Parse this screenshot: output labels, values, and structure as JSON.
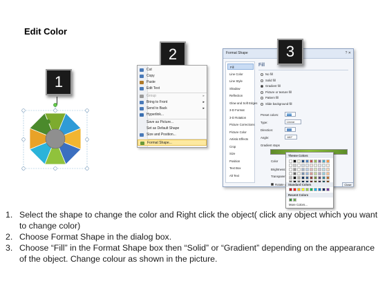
{
  "title": "Edit Color",
  "badges": [
    "1",
    "2",
    "3"
  ],
  "context_menu": {
    "items": [
      {
        "label": "Cut",
        "icon": "scissors-icon",
        "state": "normal"
      },
      {
        "label": "Copy",
        "icon": "copy-icon",
        "state": "normal"
      },
      {
        "label": "Paste",
        "icon": "paste-icon",
        "state": "normal"
      },
      {
        "label": "Edit Text",
        "icon": "text-icon",
        "state": "normal"
      },
      {
        "label": "Group",
        "icon": "group-icon",
        "state": "disabled",
        "submenu": true
      },
      {
        "label": "Bring to Front",
        "icon": "bring-front-icon",
        "state": "normal",
        "submenu": true
      },
      {
        "label": "Send to Back",
        "icon": "send-back-icon",
        "state": "normal",
        "submenu": true
      },
      {
        "label": "Hyperlink...",
        "icon": "hyperlink-icon",
        "state": "normal"
      },
      {
        "label": "Save as Picture...",
        "icon": "",
        "state": "normal"
      },
      {
        "label": "Set as Default Shape",
        "icon": "",
        "state": "normal"
      },
      {
        "label": "Size and Position...",
        "icon": "size-icon",
        "state": "normal"
      },
      {
        "label": "Format Shape...",
        "icon": "format-shape-icon",
        "state": "highlighted"
      }
    ]
  },
  "format_dialog": {
    "title": "Format Shape",
    "window_buttons": "? ✕",
    "nav": [
      "Fill",
      "Line Color",
      "Line Style",
      "Shadow",
      "Reflection",
      "Glow and Soft Edges",
      "3-D Format",
      "3-D Rotation",
      "Picture Corrections",
      "Picture Color",
      "Artistic Effects",
      "Crop",
      "Size",
      "Position",
      "Text Box",
      "Alt Text"
    ],
    "selected_nav": "Fill",
    "panel_heading": "Fill",
    "fill_options": [
      {
        "label": "No fill",
        "checked": false
      },
      {
        "label": "Solid fill",
        "checked": false
      },
      {
        "label": "Gradient fill",
        "checked": true
      },
      {
        "label": "Picture or texture fill",
        "checked": false
      },
      {
        "label": "Pattern fill",
        "checked": false
      },
      {
        "label": "Slide background fill",
        "checked": false
      }
    ],
    "preset_colors_label": "Preset colors:",
    "type_label": "Type:",
    "type_value": "Linear",
    "direction_label": "Direction:",
    "angle_label": "Angle:",
    "angle_value": "180°",
    "gradient_stops_label": "Gradient stops",
    "color_label": "Color",
    "position_label": "Position:",
    "position_value": "0%",
    "brightness_label": "Brightness:",
    "transparency_label": "Transparency:",
    "rotate_label": "Rotate with shape",
    "close_label": "Close"
  },
  "color_picker": {
    "theme_header": "Theme Colors",
    "standard_header": "Standard Colors",
    "recent_header": "Recent Colors",
    "more_label": "More Colors...",
    "theme_top": [
      "#ffffff",
      "#000000",
      "#eeece1",
      "#1f497d",
      "#4f81bd",
      "#c0504d",
      "#9bbb59",
      "#8064a2",
      "#4bacc6",
      "#f79646"
    ],
    "standard": [
      "#c00000",
      "#ff0000",
      "#ffc000",
      "#ffff00",
      "#92d050",
      "#00b050",
      "#00b0f0",
      "#0070c0",
      "#002060",
      "#7030a0"
    ],
    "recent": [
      "#3c8d3c",
      "#6aa84f"
    ]
  },
  "steps": [
    {
      "num": "1.",
      "text": "Select the shape to change the color and Right click the object( click any object which you want to change color)"
    },
    {
      "num": "2.",
      "text": "Choose Format Shape in the dialog box."
    },
    {
      "num": "3.",
      "text": "Choose “Fill” in the Format Shape box then “Solid” or “Gradient” depending on the appearance of the object. Change colour as shown in the picture."
    }
  ],
  "colors": {
    "puzzle_pieces": [
      "#7dab2e",
      "#2f9bd7",
      "#f1b531",
      "#3b6fc0",
      "#90c23c",
      "#2bb3d9",
      "#e8a227",
      "#4b8a2c"
    ],
    "puzzle_center": "#8f8f8f",
    "badge_bg": "#1a1a1a"
  }
}
